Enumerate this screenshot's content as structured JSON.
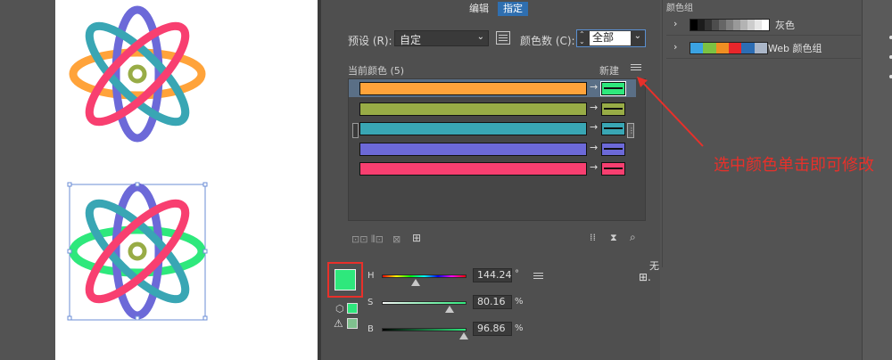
{
  "dialog": {
    "tabs": [
      "编辑",
      "指定"
    ],
    "preset_label": "预设 (R):",
    "preset_value": "自定",
    "colors_count_label": "颜色数 (C):",
    "colors_count_value": "全部",
    "current_colors_label": "当前颜色 (5)",
    "new_label": "新建",
    "rows": [
      {
        "current": "#ffa33a",
        "new": "#2ee87c",
        "selected": true
      },
      {
        "current": "#98ac46",
        "new": "#98ac46",
        "selected": false
      },
      {
        "current": "#39a6b4",
        "new": "#39a6b4",
        "selected": false
      },
      {
        "current": "#6c69d8",
        "new": "#6c69d8",
        "selected": false
      },
      {
        "current": "#f83f70",
        "new": "#f83f70",
        "selected": false
      }
    ],
    "selected_color": "#2ee87c",
    "none_label": "无",
    "hsb": {
      "h_label": "H",
      "h_value": "144.24",
      "h_unit": "°",
      "s_label": "S",
      "s_value": "80.16",
      "s_unit": "%",
      "b_label": "B",
      "b_value": "96.86",
      "b_unit": "%",
      "h_level": 0.4,
      "s_level": 0.8,
      "b_level": 0.97
    }
  },
  "color_groups": {
    "title": "颜色组",
    "groups": [
      {
        "name": "灰色"
      },
      {
        "name": "Web 颜色组"
      }
    ]
  },
  "annotation": {
    "text": "选中颜色单击即可修改",
    "color": "#e8302a"
  },
  "artwork": {
    "colors_original": [
      "#ffa33a",
      "#98ac46",
      "#39a6b4",
      "#6c69d8",
      "#f83f70"
    ],
    "colors_recolored": [
      "#2ee87c",
      "#98ac46",
      "#39a6b4",
      "#6c69d8",
      "#f83f70"
    ]
  }
}
